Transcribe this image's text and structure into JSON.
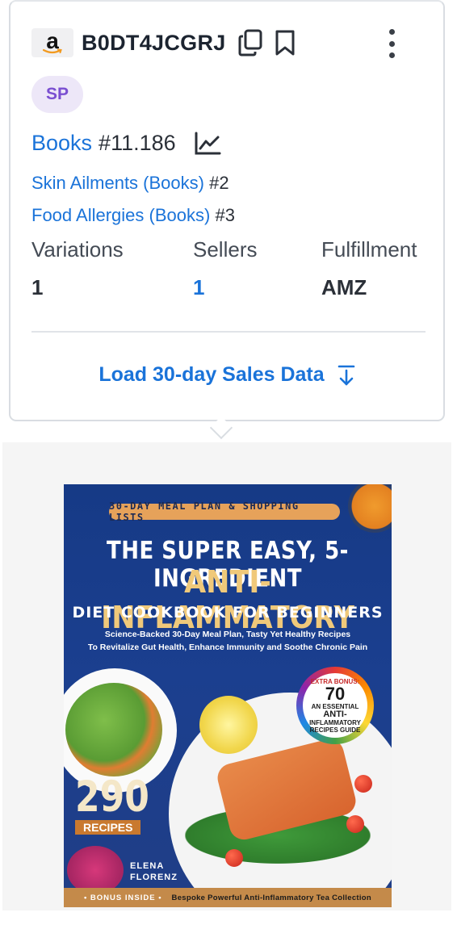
{
  "product": {
    "asin": "B0DT4JCGRJ",
    "badge": "SP",
    "logo_icon": "amazon-logo-icon"
  },
  "ranks": {
    "main": {
      "category": "Books",
      "rank": "#11.186"
    },
    "sub": [
      {
        "category": "Skin Ailments (Books)",
        "rank": "#2"
      },
      {
        "category": "Food Allergies (Books)",
        "rank": "#3"
      }
    ]
  },
  "stats": {
    "variations": {
      "label": "Variations",
      "value": "1"
    },
    "sellers": {
      "label": "Sellers",
      "value": "1"
    },
    "fulfillment": {
      "label": "Fulfillment",
      "value": "AMZ"
    }
  },
  "actions": {
    "load_sales": "Load 30-day Sales Data"
  },
  "cover": {
    "pill": "30-DAY MEAL PLAN & SHOPPING LISTS",
    "title_line1": "THE SUPER EASY, 5-INGREDIENT",
    "title_line2": "ANTI-INFLAMMATORY",
    "title_line3": "DIET COOKBOOK FOR BEGINNERS",
    "subtitle_line1": "Science-Backed 30-Day Meal Plan, Tasty Yet Healthy Recipes",
    "subtitle_line2": "To Revitalize Gut Health, Enhance Immunity and Soothe Chronic Pain",
    "bonus_label": "EXTRA BONUS:",
    "bonus_number": "70",
    "bonus_text1": "AN ESSENTIAL",
    "bonus_text2": "ANTI-",
    "bonus_text3": "INFLAMMATORY",
    "bonus_text4": "RECIPES GUIDE",
    "recipes_number": "290",
    "recipes_label": "RECIPES",
    "author_first": "ELENA",
    "author_last": "FLORENZ",
    "footer_bonus": "• BONUS INSIDE •",
    "footer_text": "Bespoke Powerful Anti-Inflammatory Tea Collection"
  },
  "colors": {
    "link": "#1a73d9",
    "badge_bg": "#ede7f8",
    "badge_text": "#7a4fd1",
    "text": "#2b3038"
  }
}
